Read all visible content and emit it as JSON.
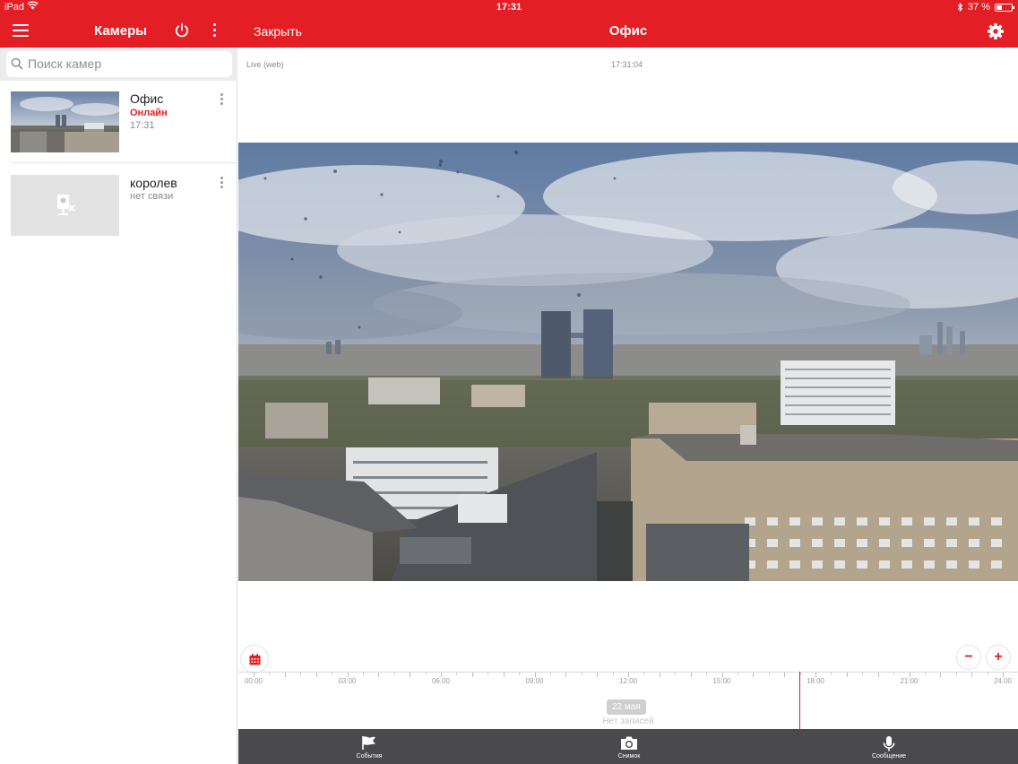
{
  "status_bar": {
    "device": "iPad",
    "time": "17:31",
    "battery": "37 %"
  },
  "sidebar": {
    "title": "Камеры",
    "search_placeholder": "Поиск камер",
    "cameras": [
      {
        "name": "Офис",
        "status": "Онлайн",
        "status_color": "#e31e24",
        "time": "17:31"
      },
      {
        "name": "королев",
        "status": "нет связи",
        "status_color": "#8a8a8a",
        "time": ""
      }
    ]
  },
  "viewer": {
    "close_label": "Закрыть",
    "title": "Офис",
    "live_label": "Live (web)",
    "live_time": "17:31:04",
    "timeline": {
      "ticks": [
        "00:00",
        "03:00",
        "06:00",
        "09:00",
        "12:00",
        "15:00",
        "18:00",
        "21:00",
        "24:00"
      ],
      "date": "22 мая",
      "no_records": "Нет записей",
      "zoom_out": "−",
      "zoom_in": "+"
    },
    "bottom_bar": {
      "events": "События",
      "snapshot": "Снимок",
      "message": "Сообщение"
    }
  },
  "colors": {
    "brand": "#e31e24",
    "bottom_bar": "#4a4a4c"
  }
}
